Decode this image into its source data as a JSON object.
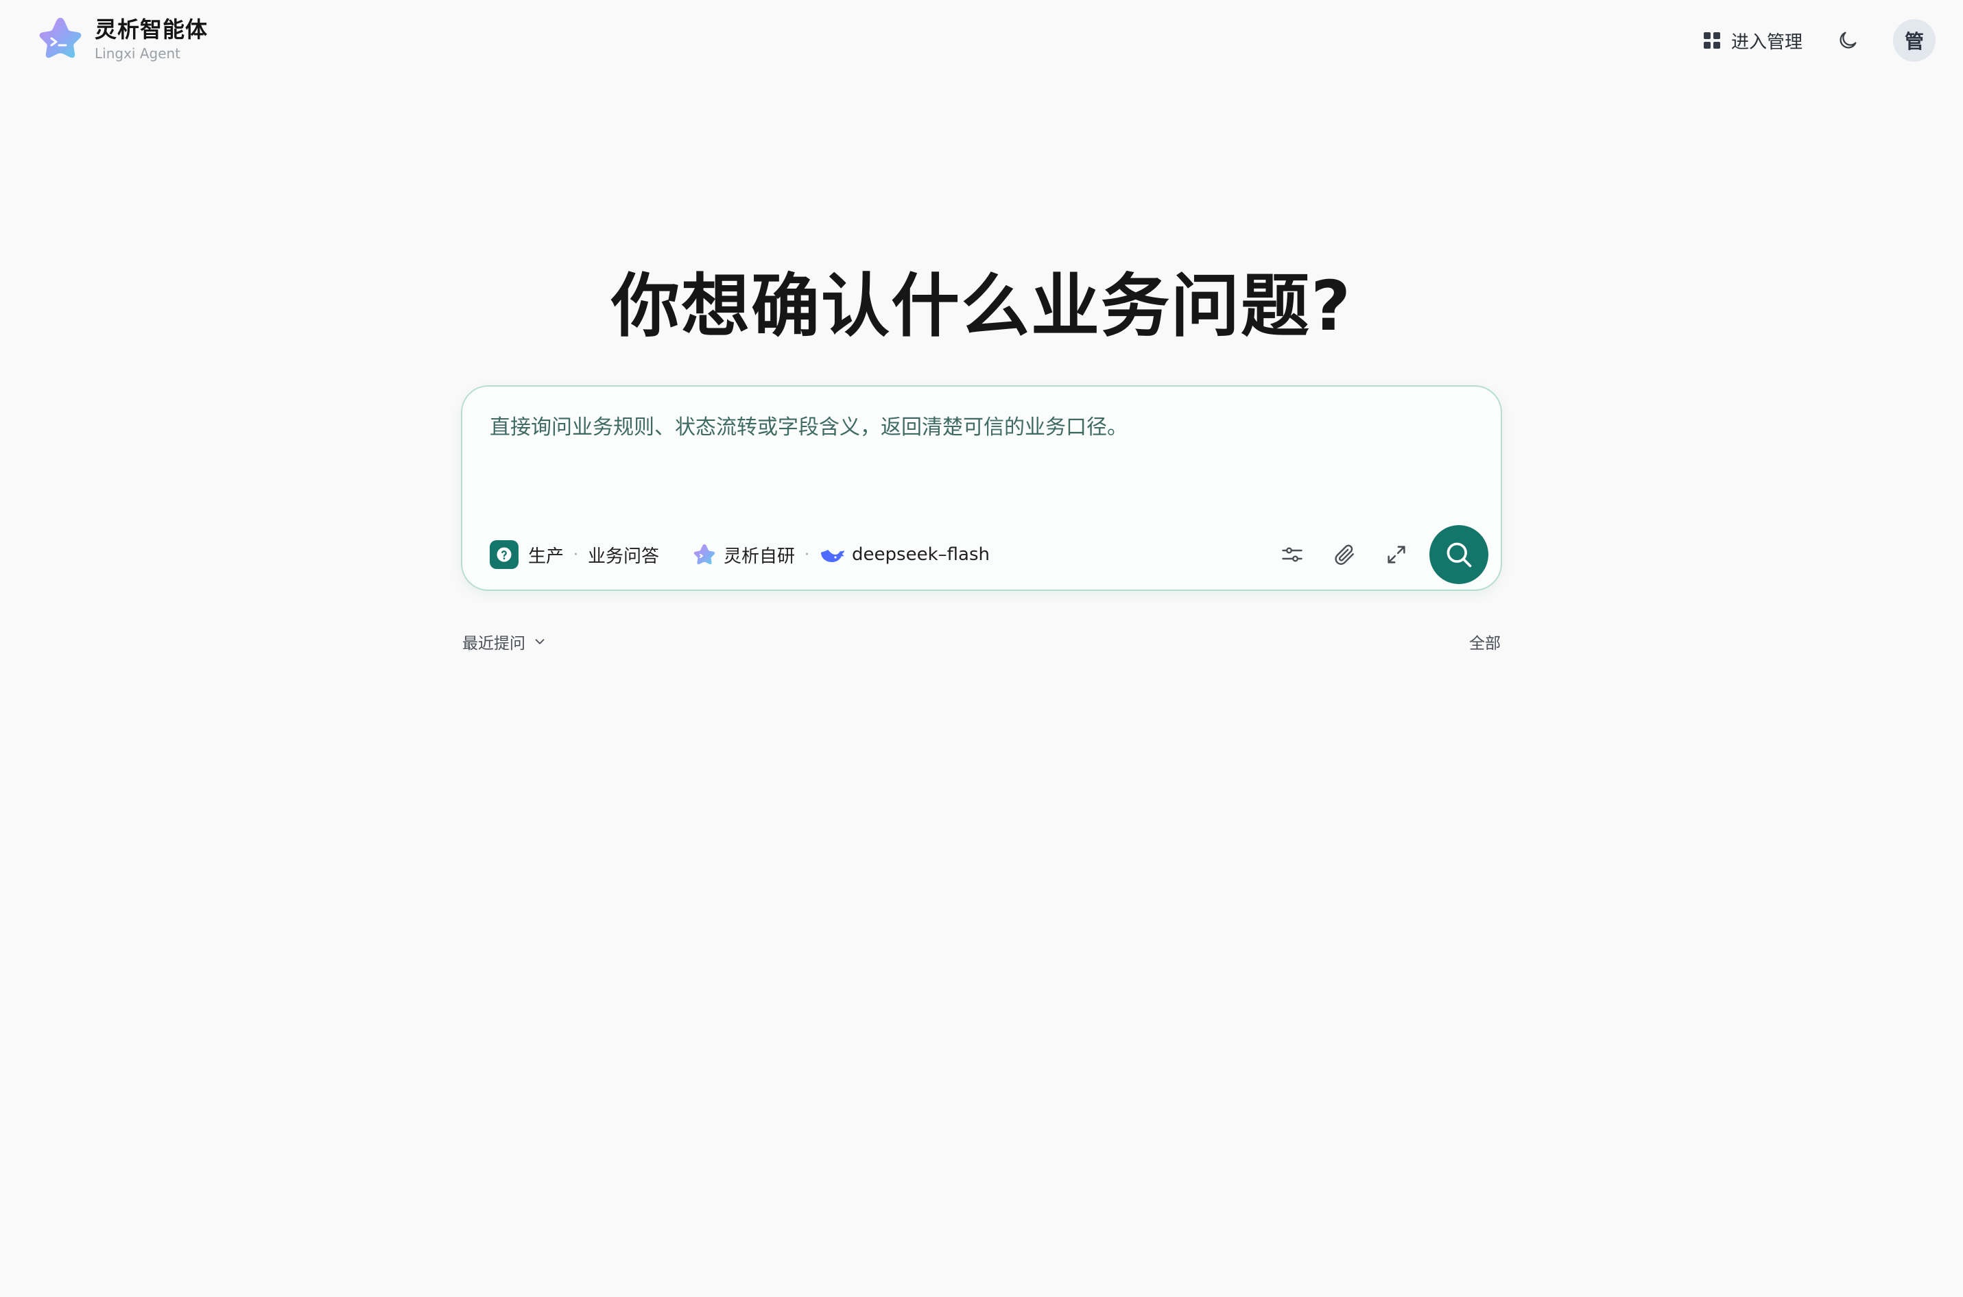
{
  "brand": {
    "title": "灵析智能体",
    "subtitle": "Lingxi Agent"
  },
  "header": {
    "admin_label": "进入管理",
    "avatar_text": "管"
  },
  "hero": {
    "title": "你想确认什么业务问题?"
  },
  "composer": {
    "value": "",
    "placeholder": "直接询问业务规则、状态流转或字段含义，返回清楚可信的业务口径。",
    "environment_label": "生产",
    "separator": "·",
    "scene_label": "业务问答",
    "model_provider_label": "灵析自研",
    "model_name": "deepseek–flash"
  },
  "recent": {
    "label": "最近提问",
    "all_label": "全部"
  },
  "colors": {
    "accent": "#14766b",
    "card_border": "#b6ddd3",
    "placeholder": "#3e6a62",
    "background": "#f9f9f9"
  }
}
